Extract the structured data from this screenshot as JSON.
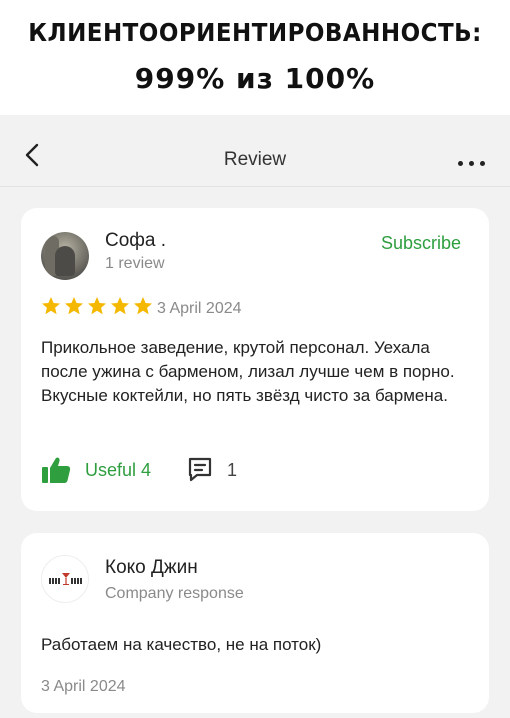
{
  "caption": {
    "line1": "КЛИЕНТООРИЕНТИРОВАННОСТЬ:",
    "line2": "999% из 100%"
  },
  "nav": {
    "title": "Review"
  },
  "review": {
    "author": "Софа .",
    "reviews_count": "1 review",
    "subscribe_label": "Subscribe",
    "rating": 5,
    "rating_max": 5,
    "date": "3 April 2024",
    "text": "Прикольное заведение, крутой персонал. Уехала после ужина с барменом, лизал лучше чем в порно. Вкусные коктейли, но пять звёзд чисто за бармена.",
    "useful_label": "Useful 4",
    "comments_count": "1"
  },
  "response": {
    "company_name": "Коко Джин",
    "tag": "Company response",
    "text": "Работаем на качество, не на поток)",
    "date": "3 April 2024"
  },
  "colors": {
    "accent_green": "#2e9e3f",
    "star_yellow": "#f5b800",
    "background": "#f2f2f2"
  },
  "icons": [
    "back-arrow-icon",
    "more-dots-icon",
    "star-icon",
    "thumbs-up-icon",
    "comment-icon"
  ]
}
